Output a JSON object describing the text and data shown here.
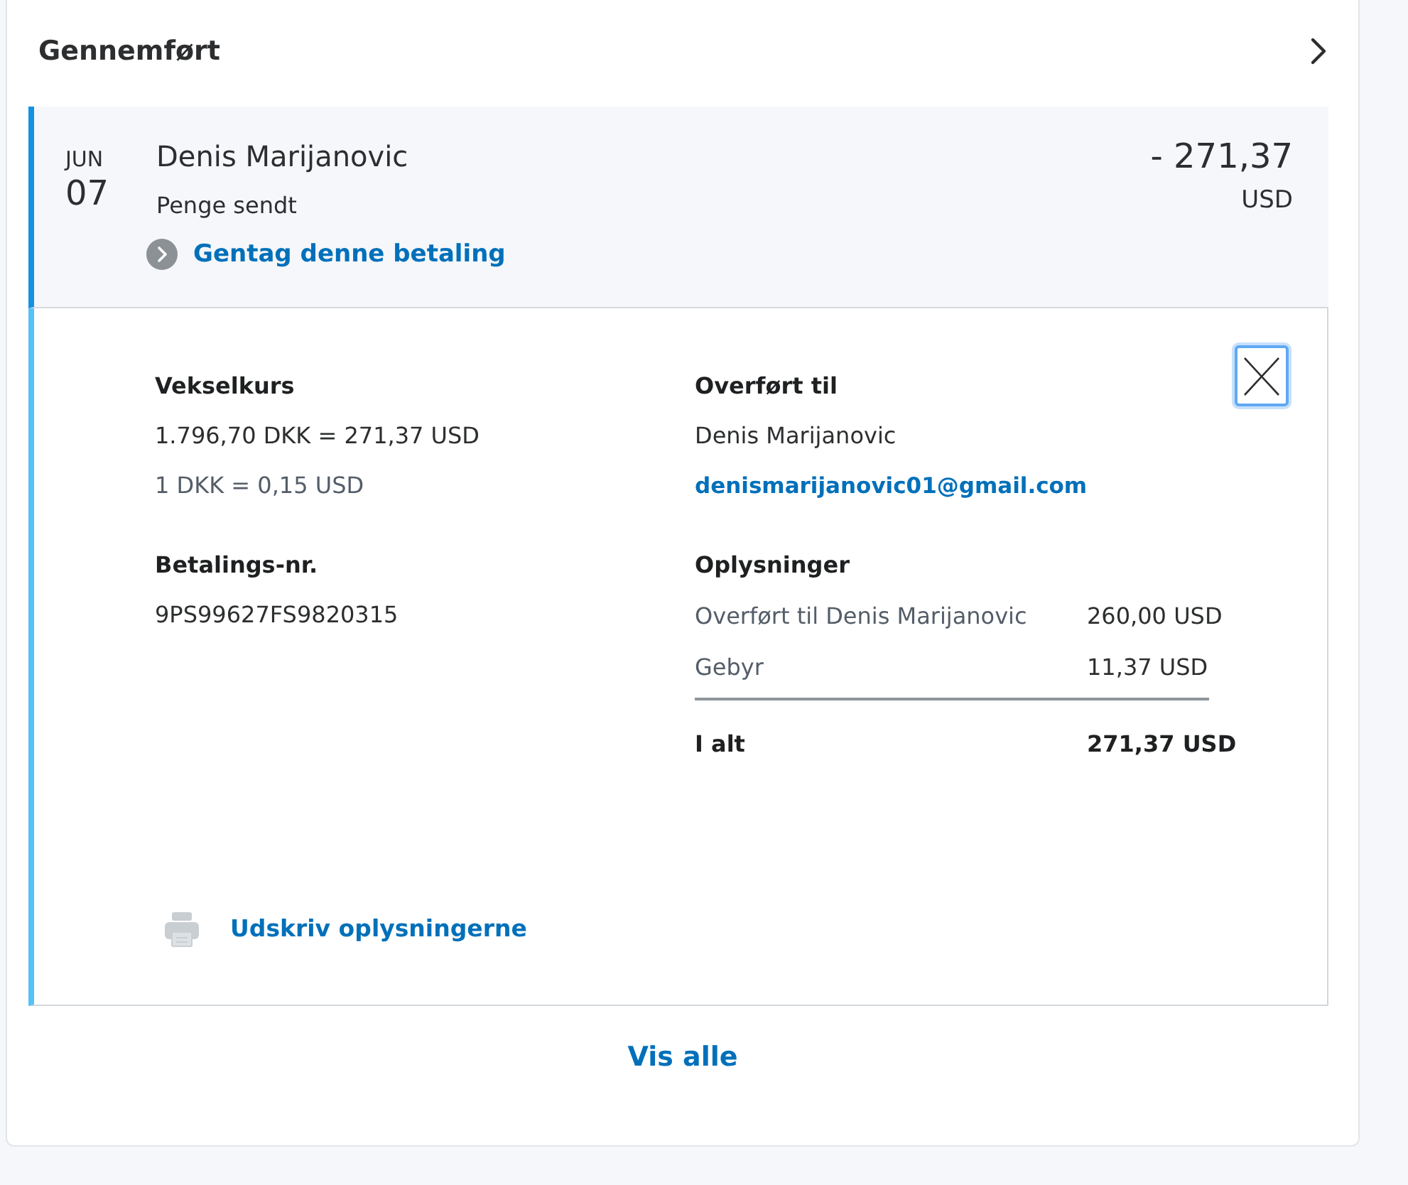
{
  "section": {
    "title": "Gennemført"
  },
  "transaction": {
    "month": "JUN",
    "day": "07",
    "name": "Denis Marijanovic",
    "type": "Penge sendt",
    "repeat_link": "Gentag denne betaling",
    "amount": "- 271,37",
    "currency": "USD",
    "expanded": true
  },
  "details": {
    "close_button": {
      "focused": true
    },
    "exchange": {
      "heading": "Vekselkurs",
      "converted": "1.796,70 DKK = 271,37 USD",
      "rate": "1 DKK = 0,15 USD"
    },
    "payment_id": {
      "heading": "Betalings-nr.",
      "value": "9PS99627FS9820315"
    },
    "recipient": {
      "heading": "Overført til",
      "name": "Denis Marijanovic",
      "email": "denismarijanovic01@gmail.com"
    },
    "info": {
      "heading": "Oplysninger",
      "rows": [
        {
          "label": "Overført til Denis Marijanovic",
          "value": "260,00 USD"
        },
        {
          "label": "Gebyr",
          "value": "11,37 USD"
        }
      ],
      "total": {
        "label": "I alt",
        "value": "271,37 USD"
      }
    },
    "print_link": "Udskriv oplysningerne"
  },
  "view_all": "Vis alle"
}
